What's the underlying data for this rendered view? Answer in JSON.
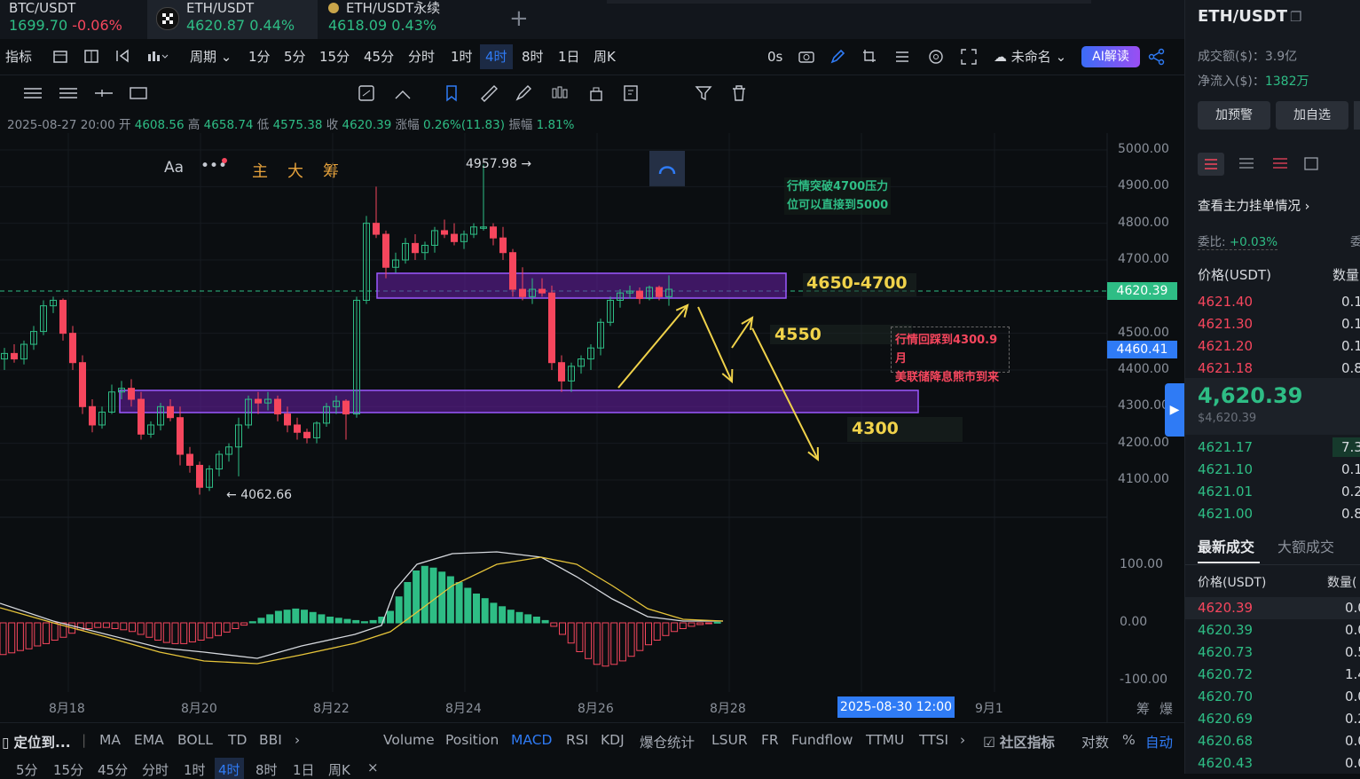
{
  "tabs": [
    {
      "symbol": "BTC/USDT",
      "price": "1699.70",
      "change": "-0.06%"
    },
    {
      "symbol": "ETH/USDT",
      "price": "4620.87",
      "change": "0.44%"
    },
    {
      "symbol": "ETH/USDT永续",
      "price": "4618.09",
      "change": "0.43%"
    }
  ],
  "toolbar": {
    "indicators": "指标",
    "period": "周期",
    "periods": [
      "1分",
      "5分",
      "15分",
      "45分",
      "分时",
      "1时",
      "4时",
      "8时",
      "1日",
      "周K"
    ],
    "countdown": "0s",
    "layout_name": "未命名",
    "ai_button": "AI解读"
  },
  "drawbar": {
    "main": "主",
    "big": "大",
    "chip": "筹"
  },
  "ohlc": {
    "date": "2025-08-27 20:00",
    "open_l": "开",
    "open": "4608.56",
    "high_l": "高",
    "high": "4658.74",
    "low_l": "低",
    "low": "4575.38",
    "close_l": "收",
    "close": "4620.39",
    "chg_l": "涨幅",
    "chg": "0.26%(11.83)",
    "amp_l": "振幅",
    "amp": "1.81%"
  },
  "chart": {
    "price_ticks": [
      "5000.00",
      "4900.00",
      "4800.00",
      "4700.00",
      "4600.00",
      "4500.00",
      "4400.00",
      "4300.00",
      "4200.00",
      "4100.00"
    ],
    "current_price": "4620.39",
    "cursor_price": "4460.41",
    "macd_ticks": [
      "100.00",
      "0.00",
      "-100.00"
    ],
    "x_ticks": [
      "8月18",
      "8月20",
      "8月22",
      "8月24",
      "8月26",
      "8月28",
      "9月1"
    ],
    "x_cursor": "2025-08-30 12:00",
    "high_label": "4957.98",
    "low_label": "4062.66",
    "annot_green_1": "行情突破4700压力",
    "annot_green_2": "位可以直接到5000",
    "annot_red_1": "行情回踩到4300.9月",
    "annot_red_2": "美联储降息熊市到来",
    "zone_upper": "4650-4700",
    "level_4550": "4550",
    "level_4300": "4300",
    "axis_extra_1": "筹",
    "axis_extra_2": "爆"
  },
  "bottombar": {
    "locate": "定位到...",
    "items": [
      "MA",
      "EMA",
      "BOLL",
      "TD",
      "BBI"
    ],
    "sub": [
      "Volume",
      "Position",
      "MACD",
      "RSI",
      "KDJ",
      "爆仓统计",
      "LSUR",
      "FR",
      "Fundflow",
      "TTMU",
      "TTSI"
    ],
    "community": "社区指标",
    "log": "对数",
    "pct": "%",
    "auto": "自动"
  },
  "bottombar2": [
    "5分",
    "15分",
    "45分",
    "分时",
    "1时",
    "4时",
    "8时",
    "1日",
    "周K"
  ],
  "right": {
    "symbol": "ETH/USDT",
    "turnover_l": "成交额($)：",
    "turnover": "3.9亿",
    "netflow_l": "净流入($)：",
    "netflow": "1382万",
    "alert_btn": "加预警",
    "fav_btn": "加自选",
    "orderbook_link": "查看主力挂单情况",
    "ratio_l": "委比:",
    "ratio": "+0.03%",
    "ratio_r": "委",
    "price_hdr": "价格(USDT)",
    "qty_hdr": "数量",
    "asks": [
      [
        "4621.40",
        "0.1"
      ],
      [
        "4621.30",
        "0.1"
      ],
      [
        "4621.20",
        "0.1"
      ],
      [
        "4621.18",
        "0.8"
      ]
    ],
    "mid": "4,620.39",
    "mid_usd": "$4,620.39",
    "bids": [
      [
        "4621.17",
        "7.3"
      ],
      [
        "4621.10",
        "0.1"
      ],
      [
        "4621.01",
        "0.2"
      ],
      [
        "4621.00",
        "0.8"
      ]
    ],
    "trade_tab1": "最新成交",
    "trade_tab2": "大额成交",
    "trade_price_hdr": "价格(USDT)",
    "trade_qty_hdr": "数量(",
    "trades": [
      [
        "4620.39",
        "0.0",
        "r"
      ],
      [
        "4620.39",
        "0.0",
        "g"
      ],
      [
        "4620.73",
        "0.5",
        "g"
      ],
      [
        "4620.72",
        "1.4",
        "g"
      ],
      [
        "4620.70",
        "0.0",
        "g"
      ],
      [
        "4620.69",
        "0.2",
        "g"
      ],
      [
        "4620.68",
        "0.0",
        "g"
      ],
      [
        "4620.43",
        "0.0",
        "g"
      ]
    ]
  },
  "colors": {
    "up": "#2ebd85",
    "down": "#f6465d",
    "accent": "#2f7bf5",
    "zone": "#6a1fa8",
    "annot": "#f0d24a"
  }
}
